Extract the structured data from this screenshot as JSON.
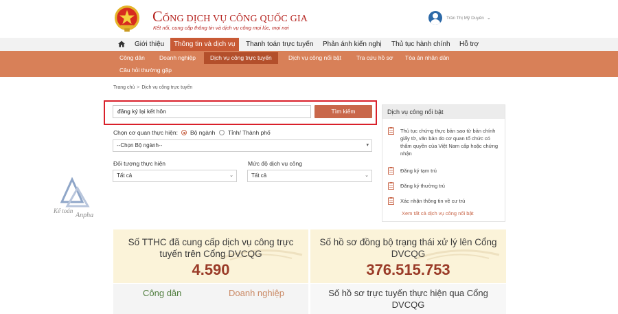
{
  "header": {
    "title_first": "C",
    "title_rest": "ỔNG DỊCH VỤ CÔNG QUỐC GIA",
    "subtitle": "Kết nối, cung cấp thông tin và dịch vụ công mọi lúc, mọi nơi",
    "user_name": "Trần Thị Mỹ Duyên",
    "colors": {
      "brand": "#b5211d",
      "accent": "#c85a35",
      "subnav": "#d88058"
    }
  },
  "topnav": {
    "items": [
      "Giới thiệu",
      "Thông tin và dịch vụ",
      "Thanh toán trực tuyến",
      "Phản ánh kiến nghị",
      "Thủ tục hành chính",
      "Hỗ trợ"
    ],
    "active": "Thông tin và dịch vụ"
  },
  "subnav": {
    "items": [
      "Công dân",
      "Doanh nghiệp",
      "Dịch vụ công trực tuyến",
      "Dịch vụ công nổi bật",
      "Tra cứu hồ sơ",
      "Tòa án nhân dân",
      "Câu hỏi thường gặp"
    ],
    "active": "Dịch vụ công trực tuyến"
  },
  "breadcrumb": {
    "home": "Trang chủ",
    "sep": ">",
    "current": "Dịch vụ công trực tuyến"
  },
  "search": {
    "value": "đăng ký lại kết hôn",
    "button": "Tìm kiếm",
    "agency_label": "Chọn cơ quan thực hiện:",
    "radio_ministry": "Bộ ngành",
    "radio_province": "Tỉnh/ Thành phố",
    "agency_select": "--Chọn Bộ ngành--",
    "subject_label": "Đối tượng thực hiện",
    "subject_select": "Tất cả",
    "level_label": "Mức độ dịch vụ công",
    "level_select": "Tất cả"
  },
  "featured": {
    "title": "Dịch vụ công nổi bật",
    "items": [
      "Thủ tục chứng thực bản sao từ bản chính giấy tờ, văn bản do cơ quan tổ chức có thẩm quyền của Việt Nam cấp hoặc chứng nhận",
      "Đăng ký tạm trú",
      "Đăng ký thường trú",
      "Xác nhận thông tin về cư trú"
    ],
    "view_all": "Xem tất cả dịch vụ công nổi bật"
  },
  "stats": {
    "online_label": "Số TTHC đã cung cấp dịch vụ công trực tuyến trên Cổng DVCQG",
    "online_value": "4.590",
    "sync_label": "Số hồ sơ đồng bộ trạng thái xử lý lên Cổng DVCQG",
    "sync_value": "376.515.753",
    "tab_citizen": "Công dân",
    "tab_business": "Doanh nghiệp",
    "online_files_label": "Số hồ sơ trực tuyến thực hiện qua Cổng DVCQG"
  },
  "watermark": {
    "line1": "Kế toán",
    "line2": "Anpha"
  }
}
